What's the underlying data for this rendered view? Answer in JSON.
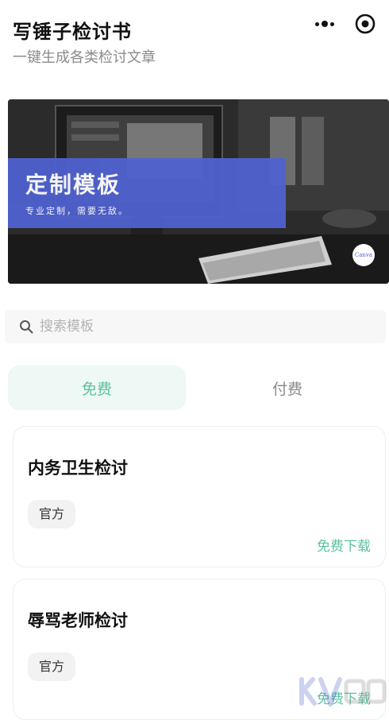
{
  "header": {
    "title": "写锤子检讨书",
    "subtitle": "一键生成各类检讨文章"
  },
  "capsule": {
    "more_icon": "more-dots-icon",
    "target_icon": "target-circle-icon"
  },
  "banner": {
    "heading": "定制模板",
    "tagline": "专业定制，需要无敌。",
    "logo_text": "Canva",
    "accent_color": "#4f61cf"
  },
  "search": {
    "icon": "search-icon",
    "placeholder": "搜索模板",
    "value": ""
  },
  "tabs": [
    {
      "label": "免费",
      "active": true
    },
    {
      "label": "付费",
      "active": false
    }
  ],
  "templates": [
    {
      "title": "内务卫生检讨",
      "tag": "官方",
      "action": "免费下载"
    },
    {
      "title": "辱骂老师检讨",
      "tag": "官方",
      "action": "免费下载"
    }
  ],
  "colors": {
    "accent_green": "#5cc1a1",
    "active_tab_bg": "#eef8f5",
    "search_bg": "#f7f7f7",
    "subtitle_gray": "#8b8b8b"
  }
}
